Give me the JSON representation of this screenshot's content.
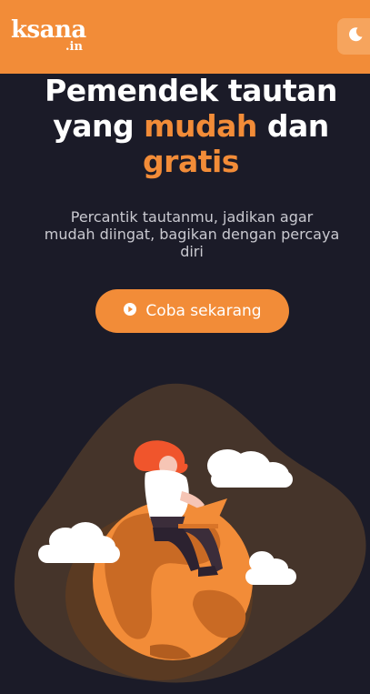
{
  "header": {
    "logo_main": "ksana",
    "logo_suffix": ".in",
    "theme_toggle_icon": "moon-icon"
  },
  "hero": {
    "title_line1": "Pemendek tautan",
    "title_line2_a": "yang ",
    "title_line2_accent": "mudah",
    "title_line2_b": " dan",
    "title_line3_accent": "gratis",
    "subtitle": "Percantik tautanmu, jadikan agar mudah diingat, bagikan dengan percaya diri",
    "cta_label": "Coba sekarang",
    "cta_icon": "play-circle-icon"
  },
  "colors": {
    "accent": "#f28c38",
    "background": "#1b1b28",
    "text": "#ffffff"
  }
}
